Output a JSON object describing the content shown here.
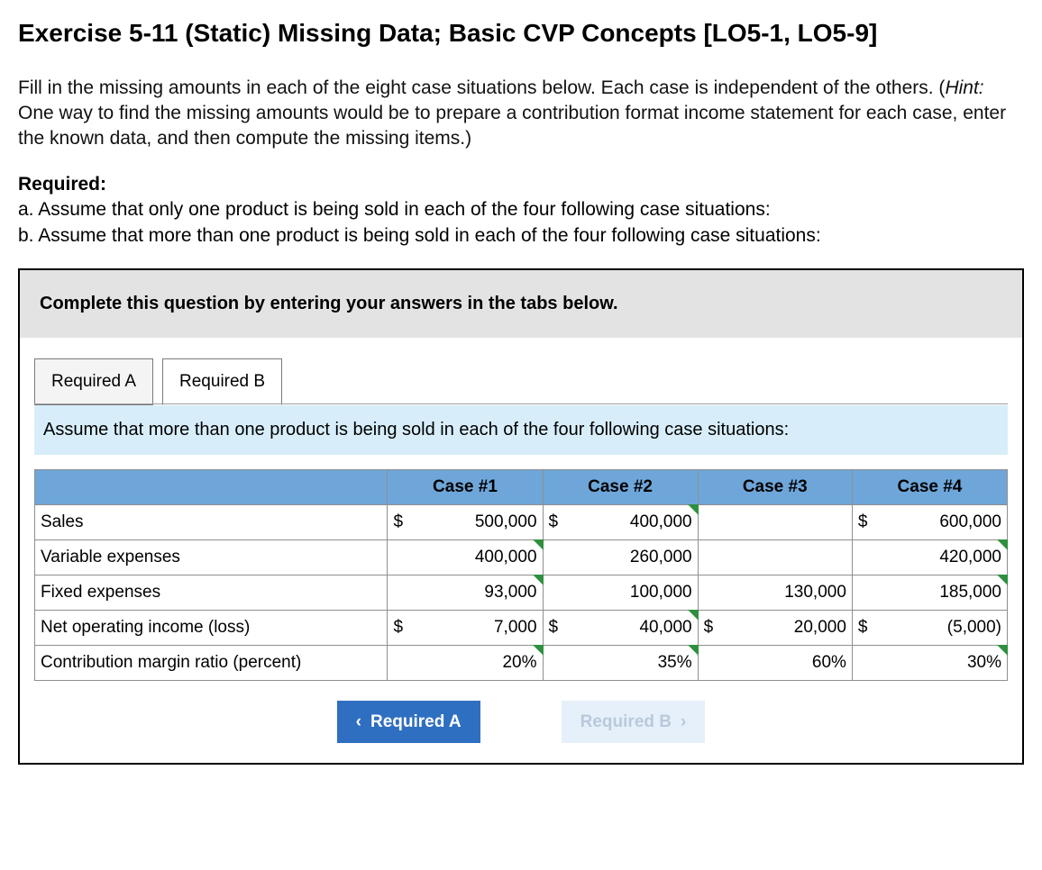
{
  "title": "Exercise 5-11 (Static) Missing Data; Basic CVP Concepts [LO5-1, LO5-9]",
  "intro_pre": "Fill in the missing amounts in each of the eight case situations below. Each case is independent of the others. (",
  "intro_hint_label": "Hint:",
  "intro_post": " One way to find the missing amounts would be to prepare a contribution format income statement for each case, enter the known data, and then compute the missing items.)",
  "required_heading": "Required:",
  "required_a": "a. Assume that only one product is being sold in each of the four following case situations:",
  "required_b": "b. Assume that more than one product is being sold in each of the four following case situations:",
  "panel_instruction": "Complete this question by entering your answers in the tabs below.",
  "tabs": {
    "a": "Required A",
    "b": "Required B"
  },
  "tab_prompt": "Assume that more than one product is being sold in each of the four following case situations:",
  "columns": [
    "Case #1",
    "Case #2",
    "Case #3",
    "Case #4"
  ],
  "rows": {
    "sales": {
      "label": "Sales",
      "c1": {
        "cur": "$",
        "val": "500,000",
        "editable": false
      },
      "c2": {
        "cur": "$",
        "val": "400,000",
        "editable": true
      },
      "c3": {
        "cur": "",
        "val": "",
        "editable": false
      },
      "c4": {
        "cur": "$",
        "val": "600,000",
        "editable": false
      }
    },
    "varexp": {
      "label": "Variable expenses",
      "c1": {
        "cur": "",
        "val": "400,000",
        "editable": true
      },
      "c2": {
        "cur": "",
        "val": "260,000",
        "editable": false
      },
      "c3": {
        "cur": "",
        "val": "",
        "editable": false
      },
      "c4": {
        "cur": "",
        "val": "420,000",
        "editable": true
      }
    },
    "fixed": {
      "label": "Fixed expenses",
      "c1": {
        "cur": "",
        "val": "93,000",
        "editable": true
      },
      "c2": {
        "cur": "",
        "val": "100,000",
        "editable": false
      },
      "c3": {
        "cur": "",
        "val": "130,000",
        "editable": false
      },
      "c4": {
        "cur": "",
        "val": "185,000",
        "editable": true
      }
    },
    "noi": {
      "label": "Net operating income (loss)",
      "c1": {
        "cur": "$",
        "val": "7,000",
        "editable": false
      },
      "c2": {
        "cur": "$",
        "val": "40,000",
        "editable": true
      },
      "c3": {
        "cur": "$",
        "val": "20,000",
        "editable": false
      },
      "c4": {
        "cur": "$",
        "val": "(5,000)",
        "editable": false
      }
    },
    "cmr": {
      "label": "Contribution margin ratio (percent)",
      "c1": {
        "cur": "",
        "val": "20%",
        "editable": true
      },
      "c2": {
        "cur": "",
        "val": "35%",
        "editable": true
      },
      "c3": {
        "cur": "",
        "val": "60%",
        "editable": false
      },
      "c4": {
        "cur": "",
        "val": "30%",
        "editable": true
      }
    }
  },
  "nav": {
    "prev": "Required A",
    "next": "Required B"
  }
}
